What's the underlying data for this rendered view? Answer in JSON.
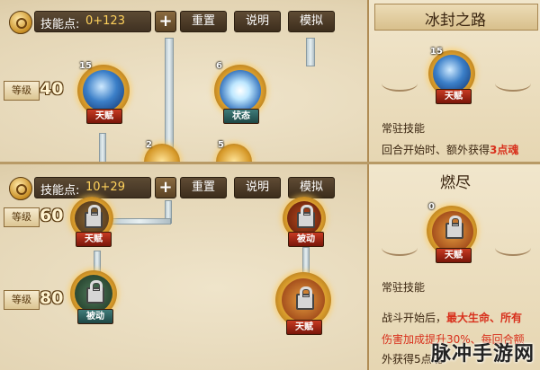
{
  "top": {
    "header": {
      "points_label": "技能点:",
      "points_value": "0+123",
      "plus": "+",
      "reset": "重置",
      "explain": "说明",
      "simulate": "模拟"
    },
    "levels": [
      {
        "label": "等级",
        "value": "40"
      }
    ],
    "nodes": [
      {
        "level": "15",
        "badge": "天赋",
        "badge_color": "#c83a22"
      },
      {
        "level": "6",
        "badge": "状态",
        "badge_color": "#3f7c7a"
      },
      {
        "level": "2"
      },
      {
        "level": "5"
      }
    ],
    "side": {
      "title": "冰封之路",
      "icon_level": "15",
      "icon_badge": "天赋",
      "type": "常驻技能",
      "desc_prefix": "回合开始时、额外获得",
      "desc_highlight": "3点魂"
    }
  },
  "bottom": {
    "header": {
      "points_label": "技能点:",
      "points_value": "10+29",
      "plus": "+",
      "reset": "重置",
      "explain": "说明",
      "simulate": "模拟"
    },
    "levels": [
      {
        "label": "等级",
        "value": "60"
      },
      {
        "label": "等级",
        "value": "80"
      }
    ],
    "nodes": [
      {
        "badge": "天赋",
        "badge_color": "#c83a22"
      },
      {
        "badge": "被动",
        "badge_color": "#c83a22"
      },
      {
        "badge": "被动",
        "badge_color": "#3f7c7a"
      },
      {
        "badge": "天赋",
        "badge_color": "#c83a22"
      }
    ],
    "side": {
      "title": "燃尽",
      "icon_level": "0",
      "icon_badge": "天赋",
      "type": "常驻技能",
      "desc_line1_prefix": "战斗开始后，",
      "desc_line1_highlight": "最大生命、所有",
      "desc_line2": "伤害加成提升30%、每回合额",
      "desc_line3": "外获得5点魂"
    }
  },
  "watermark": "脉冲手游网"
}
